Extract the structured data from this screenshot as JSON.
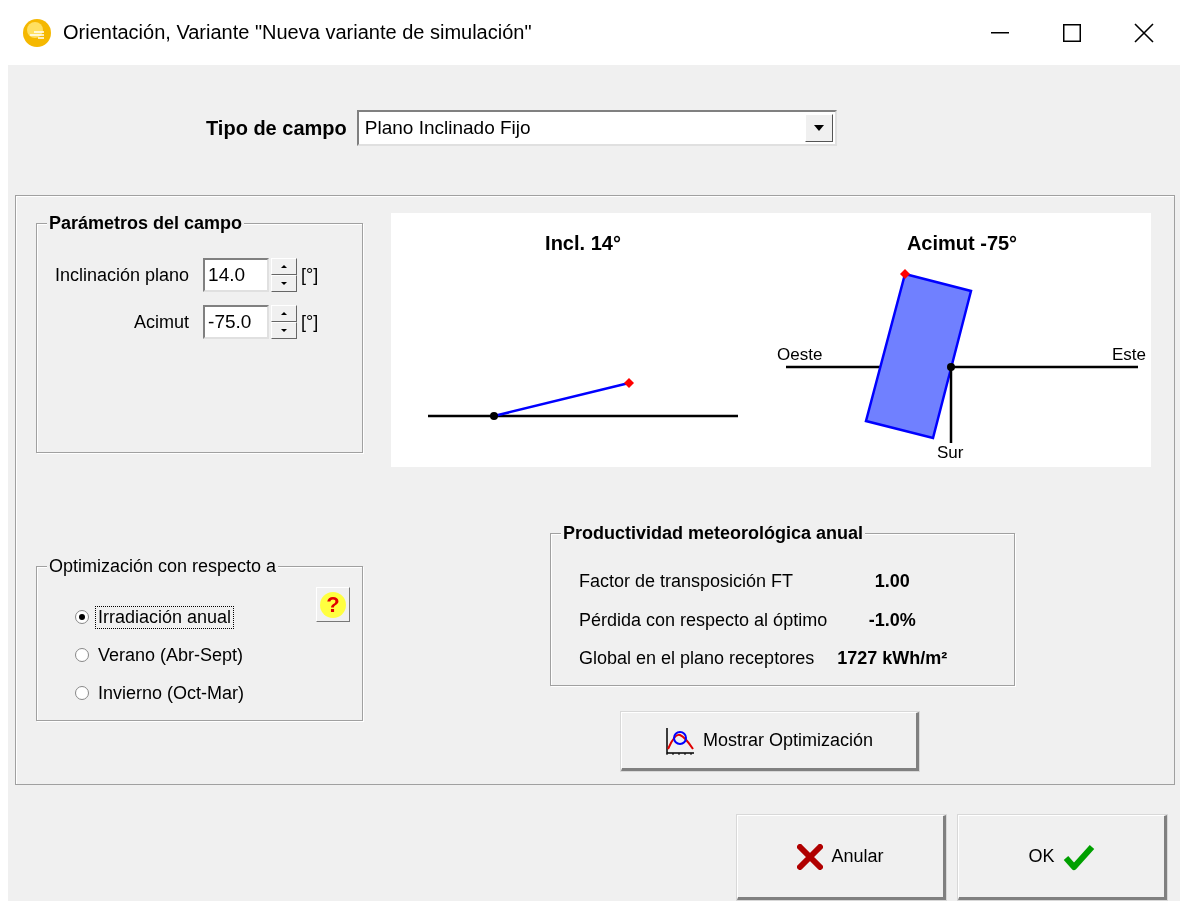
{
  "window": {
    "title": "Orientación, Variante \"Nueva variante de simulación\""
  },
  "field_type": {
    "label": "Tipo de campo",
    "value": "Plano Inclinado Fijo"
  },
  "parameters": {
    "title": "Parámetros del campo",
    "fields": [
      {
        "label": "Inclinación plano",
        "value": "14.0",
        "unit": "[°]"
      },
      {
        "label": "Acimut",
        "value": "-75.0",
        "unit": "[°]"
      }
    ]
  },
  "diagrams": {
    "tilt_title": "Incl. 14°",
    "azimuth_title": "Acimut -75°",
    "west": "Oeste",
    "east": "Este",
    "south": "Sur"
  },
  "optimization": {
    "title": "Optimización con respecto a",
    "help_button": "?",
    "options": [
      {
        "label": "Irradiación anual",
        "selected": true
      },
      {
        "label": "Verano (Abr-Sept)",
        "selected": false
      },
      {
        "label": "Invierno (Oct-Mar)",
        "selected": false
      }
    ]
  },
  "productivity": {
    "title": "Productividad meteorológica anual",
    "rows": [
      {
        "label": "Factor de transposición FT",
        "value": "1.00"
      },
      {
        "label": "Pérdida con respecto al óptimo",
        "value": "-1.0%"
      },
      {
        "label": "Global en el plano receptores",
        "value": "1727 kWh/m²"
      }
    ]
  },
  "show_button": "Mostrar Optimización",
  "buttons": [
    {
      "label": "Anular",
      "kind": "cancel"
    },
    {
      "label": "OK",
      "kind": "ok"
    }
  ]
}
